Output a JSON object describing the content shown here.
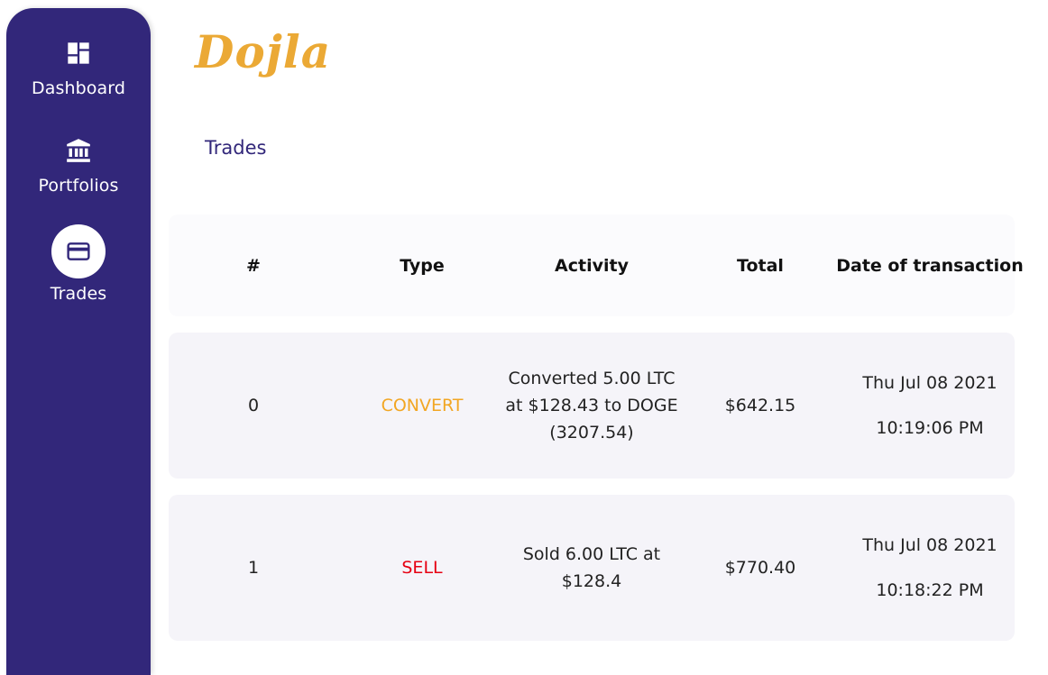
{
  "app": {
    "logo": "Dojla"
  },
  "sidebar": {
    "items": [
      {
        "label": "Dashboard",
        "icon": "dashboard-icon"
      },
      {
        "label": "Portfolios",
        "icon": "bank-icon"
      },
      {
        "label": "Trades",
        "icon": "credit-card-icon",
        "active": true
      }
    ]
  },
  "page": {
    "title": "Trades"
  },
  "table": {
    "columns": [
      "#",
      "Type",
      "Activity",
      "Total",
      "Date of transaction"
    ],
    "rows": [
      {
        "num": "0",
        "type": "CONVERT",
        "activity": "Converted 5.00 LTC at $128.43 to DOGE (3207.54)",
        "total": "$642.15",
        "date": "Thu Jul 08 2021",
        "time": "10:19:06 PM"
      },
      {
        "num": "1",
        "type": "SELL",
        "activity": "Sold 6.00 LTC at $128.4",
        "total": "$770.40",
        "date": "Thu Jul 08 2021",
        "time": "10:18:22 PM"
      }
    ]
  },
  "colors": {
    "sidebar": "#32277a",
    "logo": "#eba935",
    "convert": "#f2a623",
    "sell": "#e60012"
  }
}
